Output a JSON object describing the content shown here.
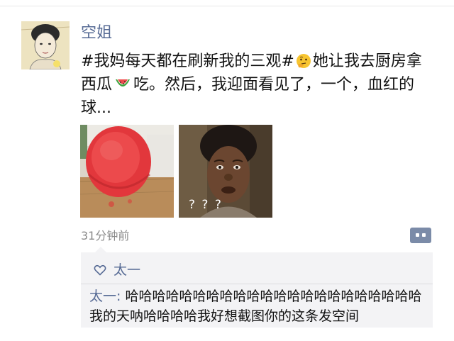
{
  "post": {
    "username": "空姐",
    "text_part1": "#我妈每天都在刷新我的三观#",
    "text_part2": "她让我去厨房拿西瓜",
    "text_part3": "吃。然后，我迎面看见了，一个，血红的球...",
    "icons": [
      "thinking-face-emoji",
      "watermelon-emoji"
    ],
    "image_overlay_text": "? ? ?",
    "timestamp": "31分钟前"
  },
  "likes": {
    "names": "太一"
  },
  "comments": [
    {
      "author": "太一",
      "separator": ": ",
      "text": "哈哈哈哈哈哈哈哈哈哈哈哈哈哈哈哈哈哈哈哈哈哈我的天呐哈哈哈哈我好想截图你的这条发空间"
    }
  ],
  "colors": {
    "link": "#576b95",
    "text": "#111111",
    "meta": "#8a8a8a",
    "panel": "#f3f3f5",
    "comment_button": "#7b8ba8"
  }
}
